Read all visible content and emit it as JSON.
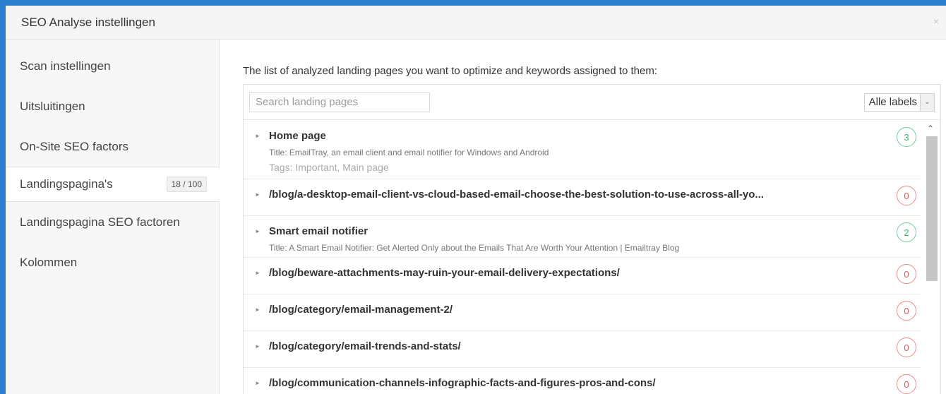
{
  "dialog": {
    "title": "SEO Analyse instellingen",
    "close_icon": "×"
  },
  "sidebar": {
    "items": [
      {
        "label": "Scan instellingen"
      },
      {
        "label": "Uitsluitingen"
      },
      {
        "label": "On-Site SEO factors"
      },
      {
        "label": "Landingspagina's",
        "badge": "18 / 100",
        "active": true
      },
      {
        "label": "Landingspagina SEO factoren"
      },
      {
        "label": "Kolommen"
      }
    ]
  },
  "main": {
    "intro": "The list of analyzed landing pages you want to optimize and keywords assigned to them:",
    "search": {
      "placeholder": "Search landing pages",
      "value": ""
    },
    "labels_select": {
      "selected": "Alle labels"
    },
    "rows": [
      {
        "name": "Home page",
        "title": "Title: EmailTray, an email client and email notifier for Windows and Android",
        "tags": "Tags: Important, Main page",
        "count": "3",
        "status": "green"
      },
      {
        "name": "/blog/a-desktop-email-client-vs-cloud-based-email-choose-the-best-solution-to-use-across-all-yo...",
        "count": "0",
        "status": "red"
      },
      {
        "name": "Smart email notifier",
        "title": "Title: A Smart Email Notifier: Get Alerted Only about the Emails That Are Worth Your Attention | Emailtray Blog",
        "count": "2",
        "status": "green"
      },
      {
        "name": "/blog/beware-attachments-may-ruin-your-email-delivery-expectations/",
        "count": "0",
        "status": "red"
      },
      {
        "name": "/blog/category/email-management-2/",
        "count": "0",
        "status": "red"
      },
      {
        "name": "/blog/category/email-trends-and-stats/",
        "count": "0",
        "status": "red"
      },
      {
        "name": "/blog/communication-channels-infographic-facts-and-figures-pros-and-cons/",
        "count": "0",
        "status": "red"
      }
    ]
  },
  "colors": {
    "accent_bg": "#2f7fd0",
    "count_green": "#3fb06e",
    "count_red": "#e05555"
  }
}
